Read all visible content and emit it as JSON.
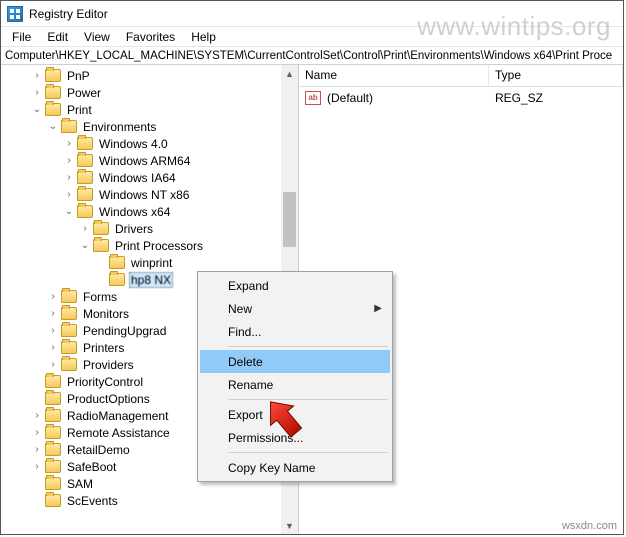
{
  "window": {
    "title": "Registry Editor"
  },
  "menus": {
    "file": "File",
    "edit": "Edit",
    "view": "View",
    "favorites": "Favorites",
    "help": "Help"
  },
  "address": "Computer\\HKEY_LOCAL_MACHINE\\SYSTEM\\CurrentControlSet\\Control\\Print\\Environments\\Windows x64\\Print Proce",
  "tree": {
    "items": [
      {
        "label": "PnP",
        "indent": 2,
        "exp": ">"
      },
      {
        "label": "Power",
        "indent": 2,
        "exp": ">"
      },
      {
        "label": "Print",
        "indent": 2,
        "exp": "v"
      },
      {
        "label": "Environments",
        "indent": 3,
        "exp": "v"
      },
      {
        "label": "Windows 4.0",
        "indent": 4,
        "exp": ">"
      },
      {
        "label": "Windows ARM64",
        "indent": 4,
        "exp": ">"
      },
      {
        "label": "Windows IA64",
        "indent": 4,
        "exp": ">"
      },
      {
        "label": "Windows NT x86",
        "indent": 4,
        "exp": ">"
      },
      {
        "label": "Windows x64",
        "indent": 4,
        "exp": "v"
      },
      {
        "label": "Drivers",
        "indent": 5,
        "exp": ">"
      },
      {
        "label": "Print Processors",
        "indent": 5,
        "exp": "v"
      },
      {
        "label": "winprint",
        "indent": 6,
        "exp": ""
      },
      {
        "label": "hp8 NX",
        "indent": 6,
        "exp": "",
        "selected": true
      },
      {
        "label": "Forms",
        "indent": 3,
        "exp": ">"
      },
      {
        "label": "Monitors",
        "indent": 3,
        "exp": ">"
      },
      {
        "label": "PendingUpgrad",
        "indent": 3,
        "exp": ">"
      },
      {
        "label": "Printers",
        "indent": 3,
        "exp": ">"
      },
      {
        "label": "Providers",
        "indent": 3,
        "exp": ">"
      },
      {
        "label": "PriorityControl",
        "indent": 2,
        "exp": ""
      },
      {
        "label": "ProductOptions",
        "indent": 2,
        "exp": ""
      },
      {
        "label": "RadioManagement",
        "indent": 2,
        "exp": ">"
      },
      {
        "label": "Remote Assistance",
        "indent": 2,
        "exp": ">"
      },
      {
        "label": "RetailDemo",
        "indent": 2,
        "exp": ">"
      },
      {
        "label": "SafeBoot",
        "indent": 2,
        "exp": ">"
      },
      {
        "label": "SAM",
        "indent": 2,
        "exp": ""
      },
      {
        "label": "ScEvents",
        "indent": 2,
        "exp": ""
      }
    ]
  },
  "list": {
    "columns": {
      "name": "Name",
      "type": "Type"
    },
    "rows": [
      {
        "icon": "ab",
        "name": "(Default)",
        "type": "REG_SZ"
      }
    ]
  },
  "context_menu": {
    "expand": "Expand",
    "new": "New",
    "find": "Find...",
    "delete": "Delete",
    "rename": "Rename",
    "export": "Export",
    "permissions": "Permissions...",
    "copy_key_name": "Copy Key Name"
  },
  "watermark": "www.wintips.org",
  "footer": "wsxdn.com"
}
